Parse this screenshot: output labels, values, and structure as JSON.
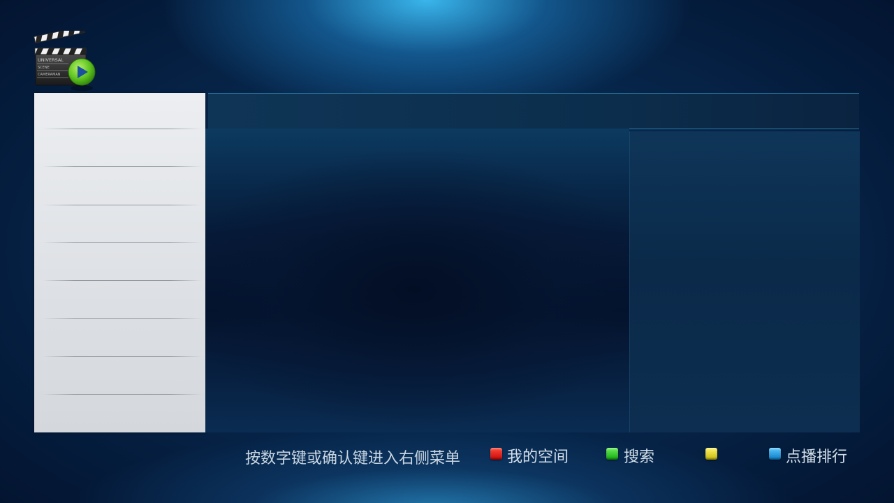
{
  "logo": {
    "icon": "clapperboard-play-icon",
    "lines": [
      "UNIVERSAL",
      "SCENE",
      "CAMERAMAN"
    ]
  },
  "left_menu": {
    "items": [
      "",
      "",
      "",
      "",
      "",
      "",
      "",
      "",
      ""
    ]
  },
  "top_bar": {
    "title": ""
  },
  "footer": {
    "hint": "按数字键或确认键进入右侧菜单",
    "buttons": [
      {
        "color": "#e01010",
        "label": "我的空间"
      },
      {
        "color": "#22c81e",
        "label": "搜索"
      },
      {
        "color": "#e6d81a",
        "label": ""
      },
      {
        "color": "#1a9ee0",
        "label": "点播排行"
      }
    ]
  }
}
